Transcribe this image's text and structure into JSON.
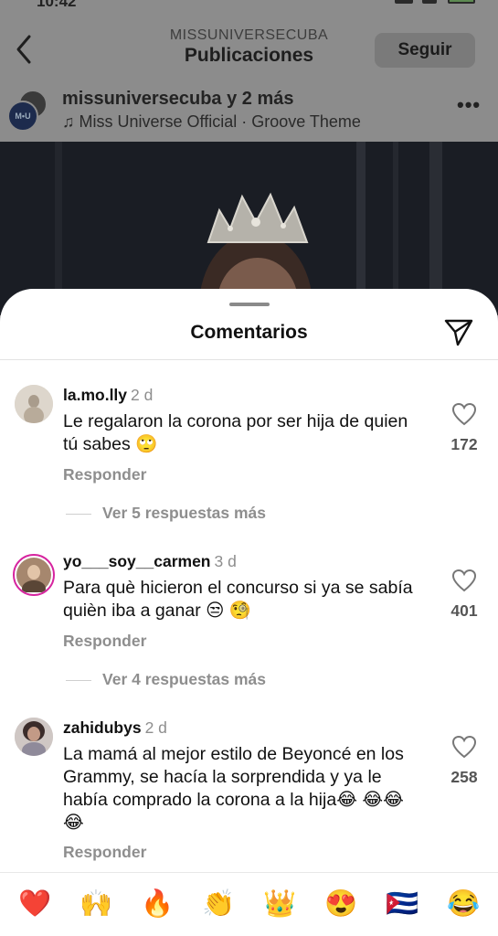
{
  "status_bar": {
    "time": "10:42"
  },
  "header": {
    "subtitle": "MISSUNIVERSECUBA",
    "title": "Publicaciones",
    "follow_label": "Seguir"
  },
  "post": {
    "author_line": "missuniversecuba y 2 más",
    "audio": "♫ Miss Universe Official · Groove Theme",
    "avatar_text": "M•U"
  },
  "comments_sheet": {
    "title": "Comentarios",
    "comments": [
      {
        "user": "la.mo.lly",
        "time": "2 d",
        "text": "Le regalaron la corona por ser hija de quien tú sabes 🙄",
        "reply_label": "Responder",
        "likes": "172",
        "more_replies": "Ver 5 respuestas más"
      },
      {
        "user": "yo___soy__carmen",
        "time": "3 d",
        "text": "Para què hicieron el concurso si ya se sabía quièn iba a ganar 😒 🧐",
        "reply_label": "Responder",
        "likes": "401",
        "more_replies": "Ver 4 respuestas más"
      },
      {
        "user": "zahidubys",
        "time": "2 d",
        "text": "La mamá al mejor estilo de Beyoncé en los Grammy, se hacía la sorprendida y ya le había comprado la corona a la hija😂 😂😂😂",
        "reply_label": "Responder",
        "likes": "258"
      }
    ]
  },
  "emoji_bar": [
    "❤️",
    "🙌",
    "🔥",
    "👏",
    "👑",
    "😍",
    "🇨🇺",
    "😂"
  ],
  "colors": {
    "sheet_bg": "#ffffff",
    "dim_overlay": "#8c8c8c",
    "secondary_text": "#8e8e8e"
  }
}
